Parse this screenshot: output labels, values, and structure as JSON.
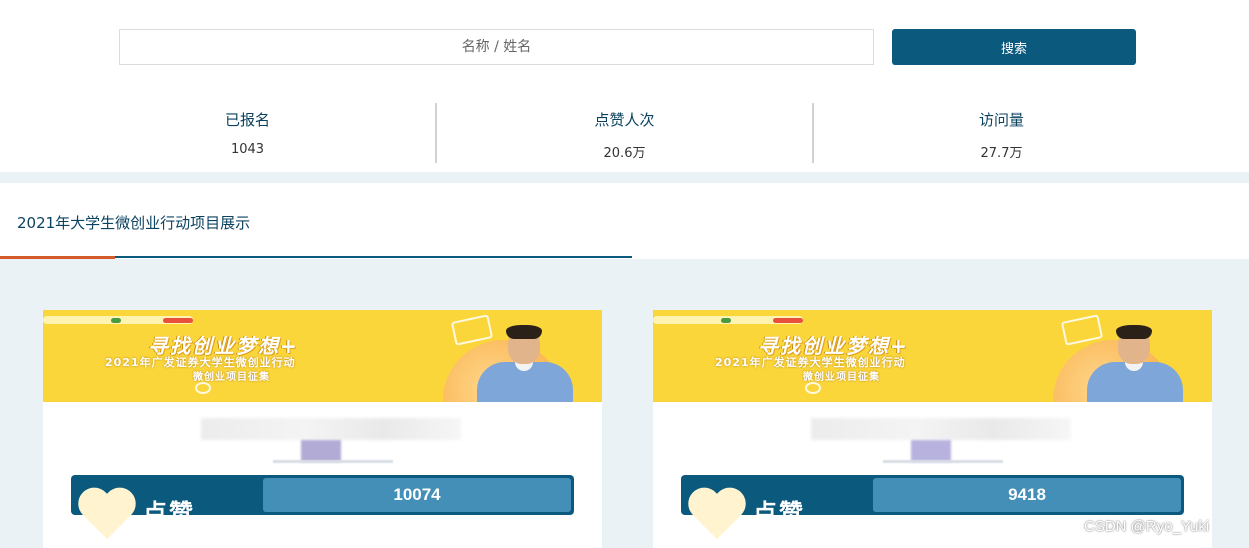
{
  "search": {
    "placeholder": "名称 / 姓名",
    "button_label": "搜索"
  },
  "stats": [
    {
      "label": "已报名",
      "value": "1043"
    },
    {
      "label": "点赞人次",
      "value": "20.6万"
    },
    {
      "label": "访问量",
      "value": "27.7万"
    }
  ],
  "section": {
    "title": "2021年大学生微创业行动项目展示"
  },
  "cards": [
    {
      "banner_headline": "寻找创业梦想+",
      "banner_sub1": "2021年广发证券大学生微创业行动",
      "banner_sub2": "微创业项目征集",
      "like_label": "点赞",
      "vote_count": "10074"
    },
    {
      "banner_headline": "寻找创业梦想+",
      "banner_sub1": "2021年广发证券大学生微创业行动",
      "banner_sub2": "微创业项目征集",
      "like_label": "点赞",
      "vote_count": "9418"
    }
  ],
  "watermark": "CSDN @Ryo_Yuki",
  "colors": {
    "primary": "#0b5a7e",
    "vote_fill": "#438fb7",
    "accent_underline": "#d75a2a",
    "banner_yellow": "#fbd63b",
    "page_bg": "#eaf2f5"
  }
}
